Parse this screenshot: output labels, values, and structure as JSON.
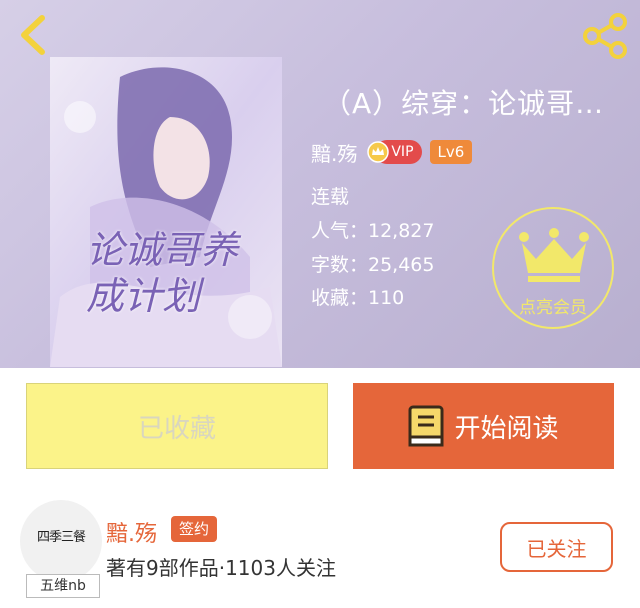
{
  "book": {
    "title": "（A）综穿：论诚哥…",
    "author": "黯.殇",
    "vip_label": "VIP",
    "level": "Lv6",
    "status": "连载",
    "popularity": "人气：12,827",
    "word_count": "字数：25,465",
    "favorites": "收藏：110",
    "cover_text": "论诚哥养成计划"
  },
  "member": {
    "label": "点亮会员"
  },
  "actions": {
    "favorited_label": "已收藏",
    "read_label": "开始阅读"
  },
  "author_card": {
    "avatar_text": "四季三餐",
    "avatar_tag": "五维nb",
    "name": "黯.殇",
    "badge": "签约",
    "works": "著有9部作品·1103人关注",
    "follow_label": "已关注"
  },
  "colors": {
    "accent": "#e5663a",
    "gold": "#f2e86a",
    "fav_bg": "#fbf389"
  }
}
